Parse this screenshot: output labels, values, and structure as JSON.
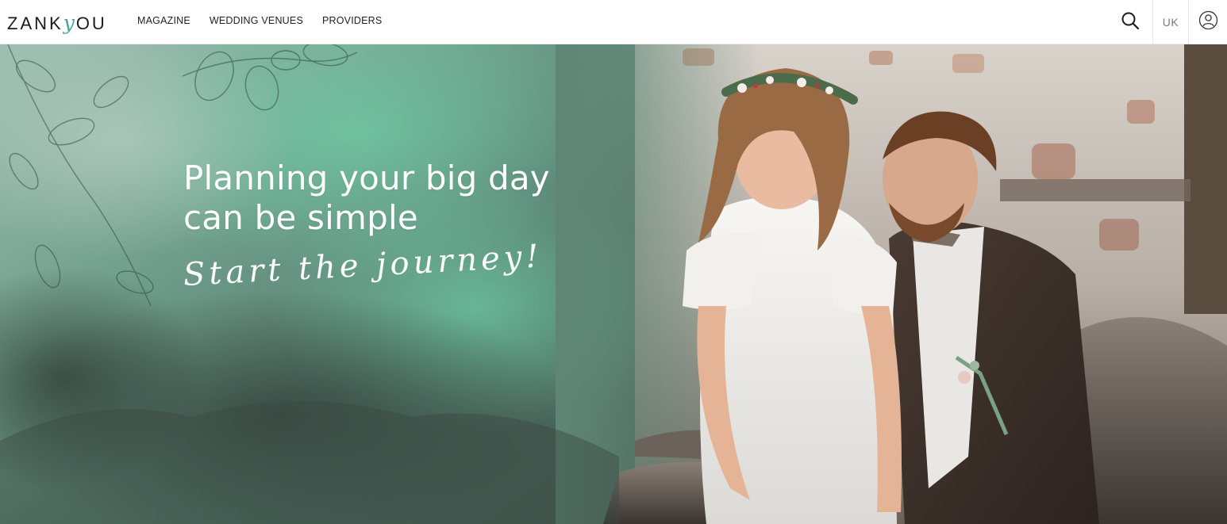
{
  "header": {
    "logo": {
      "prefix": "ZANK",
      "mark": "y",
      "suffix": "OU"
    },
    "nav": [
      {
        "label": "MAGAZINE"
      },
      {
        "label": "WEDDING VENUES"
      },
      {
        "label": "PROVIDERS"
      }
    ],
    "language": "UK",
    "icons": {
      "search": "search-icon",
      "account": "user-account-icon"
    }
  },
  "hero": {
    "title_line1": "Planning your big day",
    "title_line2": "can be simple",
    "script": "Start the journey!"
  },
  "colors": {
    "brand_teal": "#4aa59a",
    "hero_text": "#ffffff",
    "nav_text": "#222222"
  }
}
